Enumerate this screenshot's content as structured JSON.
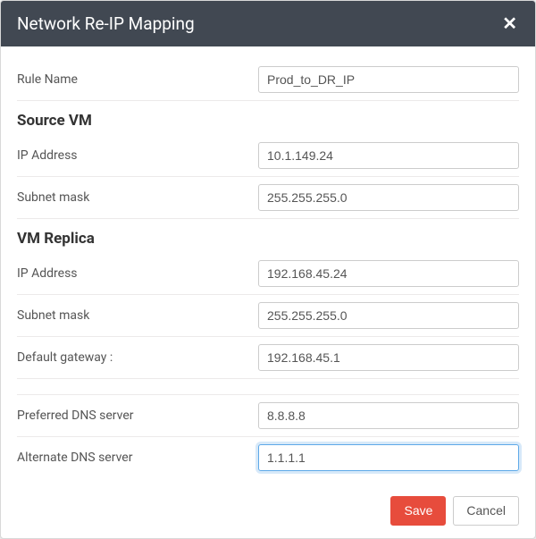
{
  "header": {
    "title": "Network Re-IP Mapping"
  },
  "rule_name": {
    "label": "Rule Name",
    "value": "Prod_to_DR_IP"
  },
  "sections": {
    "source_vm": {
      "heading": "Source VM",
      "ip_address": {
        "label": "IP Address",
        "value": "10.1.149.24"
      },
      "subnet_mask": {
        "label": "Subnet mask",
        "value": "255.255.255.0"
      }
    },
    "vm_replica": {
      "heading": "VM Replica",
      "ip_address": {
        "label": "IP Address",
        "value": "192.168.45.24"
      },
      "subnet_mask": {
        "label": "Subnet mask",
        "value": "255.255.255.0"
      },
      "default_gateway": {
        "label": "Default gateway :",
        "value": "192.168.45.1"
      },
      "preferred_dns": {
        "label": "Preferred DNS server",
        "value": "8.8.8.8"
      },
      "alternate_dns": {
        "label": "Alternate DNS server",
        "value": "1.1.1.1"
      }
    }
  },
  "footer": {
    "save": "Save",
    "cancel": "Cancel"
  }
}
